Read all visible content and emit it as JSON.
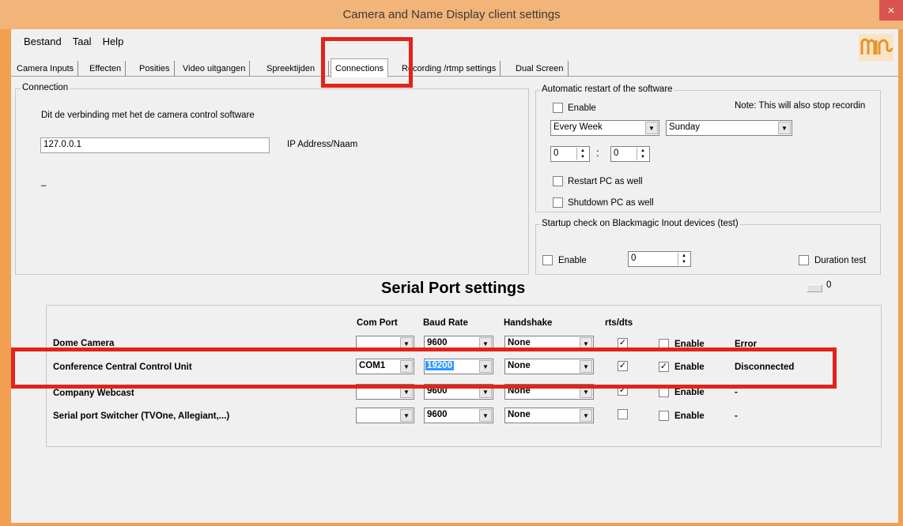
{
  "window": {
    "title": "Camera and Name Display client settings",
    "close_label": "×"
  },
  "menu": {
    "items": [
      "Bestand",
      "Taal",
      "Help"
    ]
  },
  "tabs": [
    "Camera Inputs",
    "Effecten",
    "Posities",
    "Video uitgangen",
    "Spreektijden",
    "Connections",
    "Recording /rtmp settings",
    "Dual Screen"
  ],
  "connection": {
    "legend": "Connection",
    "description": "Dit de verbinding met het de camera control software",
    "ip_value": "127.0.0.1",
    "ip_label": "IP Address/Naam",
    "status": "–"
  },
  "restart": {
    "legend": "Automatic restart of the software",
    "enable_label": "Enable",
    "note": "Note: This will also stop recordin",
    "frequency": "Every Week",
    "day": "Sunday",
    "hour": "0",
    "minute": "0",
    "separator": ":",
    "restart_pc_label": "Restart PC as well",
    "shutdown_pc_label": "Shutdown PC as well"
  },
  "blackmagic": {
    "legend": "Startup check on Blackmagic Inout devices (test)",
    "enable_label": "Enable",
    "value": "0",
    "duration_label": "Duration test",
    "counter": "0"
  },
  "serial": {
    "heading": "Serial Port settings",
    "headers": {
      "com_port": "Com Port",
      "baud_rate": "Baud Rate",
      "handshake": "Handshake",
      "rts": "rts/dts"
    },
    "rows": [
      {
        "name": "Dome Camera",
        "com": "",
        "baud": "9600",
        "handshake": "None",
        "rts": "✓",
        "enable_label": "Enable",
        "enabled": "",
        "status": "Error"
      },
      {
        "name": "Conference Central Control Unit",
        "com": "COM1",
        "baud": "19200",
        "handshake": "None",
        "rts": "✓",
        "enable_label": "Enable",
        "enabled": "✓",
        "status": "Disconnected"
      },
      {
        "name": "Company Webcast",
        "com": "",
        "baud": "9600",
        "handshake": "None",
        "rts": "✓",
        "enable_label": "Enable",
        "enabled": "",
        "status": "-"
      },
      {
        "name": "Serial port Switcher (TVOne, Allegiant,...)",
        "com": "",
        "baud": "9600",
        "handshake": "None",
        "rts": "",
        "enable_label": "Enable",
        "enabled": "",
        "status": "-"
      }
    ]
  },
  "colors": {
    "highlight": "#e2231a",
    "title_bar": "#f2b478",
    "selection": "#3399ff"
  }
}
